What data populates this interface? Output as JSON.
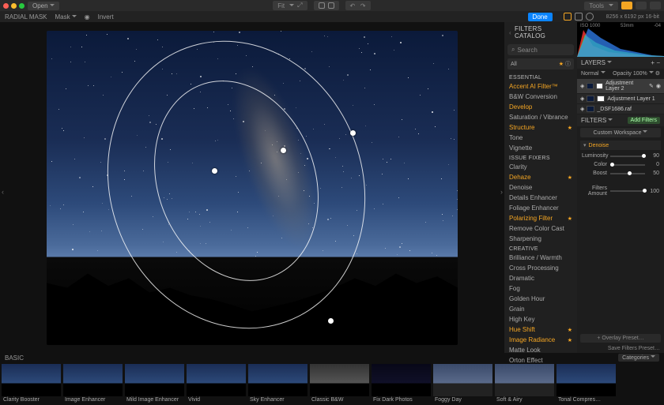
{
  "topbar": {
    "open": "Open"
  },
  "secbar": {
    "title": "RADIAL MASK",
    "mask": "Mask",
    "invert": "Invert",
    "tools": "Tools",
    "done": "Done",
    "imginfo": "8256 x 6192 px   16-bit"
  },
  "histo": {
    "iso": "ISO 1000",
    "focal": "53mm",
    "ev": "-04"
  },
  "catalog": {
    "title": "FILTERS CATALOG",
    "search_ph": "Search",
    "all": "All",
    "sections": [
      {
        "label": "ESSENTIAL",
        "items": [
          {
            "label": "Accent AI Filter™",
            "hl": true
          },
          {
            "label": "B&W Conversion"
          },
          {
            "label": "Develop",
            "hl": true
          },
          {
            "label": "Saturation / Vibrance"
          },
          {
            "label": "Structure",
            "hl": true,
            "fav": true
          },
          {
            "label": "Tone"
          },
          {
            "label": "Vignette"
          }
        ]
      },
      {
        "label": "ISSUE FIXERS",
        "items": [
          {
            "label": "Clarity"
          },
          {
            "label": "Dehaze",
            "hl": true,
            "fav": true
          },
          {
            "label": "Denoise"
          },
          {
            "label": "Details Enhancer"
          },
          {
            "label": "Foliage Enhancer"
          },
          {
            "label": "Polarizing Filter",
            "hl": true,
            "fav": true
          },
          {
            "label": "Remove Color Cast"
          },
          {
            "label": "Sharpening"
          }
        ]
      },
      {
        "label": "CREATIVE",
        "items": [
          {
            "label": "Brilliance / Warmth"
          },
          {
            "label": "Cross Processing"
          },
          {
            "label": "Dramatic"
          },
          {
            "label": "Fog"
          },
          {
            "label": "Golden Hour"
          },
          {
            "label": "Grain"
          },
          {
            "label": "High Key"
          },
          {
            "label": "Hue Shift",
            "hl": true,
            "fav": true
          },
          {
            "label": "Image Radiance",
            "hl": true,
            "fav": true
          },
          {
            "label": "Matte Look"
          },
          {
            "label": "Orton Effect"
          }
        ]
      }
    ]
  },
  "layers": {
    "title": "LAYERS",
    "blend": "Normal",
    "opacity_label": "Opacity",
    "opacity": "100%",
    "items": [
      {
        "name": "Adjustment Layer 2",
        "sel": true
      },
      {
        "name": "Adjustment Layer 1"
      },
      {
        "name": "_DSF1686.raf"
      }
    ]
  },
  "filters": {
    "title": "FILTERS",
    "add": "Add Filters",
    "workspace": "Custom Workspace",
    "group": "Denoise",
    "sliders": [
      {
        "name": "Luminosity",
        "value": 90,
        "pos": 90
      },
      {
        "name": "Color",
        "value": 0,
        "pos": 0
      },
      {
        "name": "Boost",
        "value": 50,
        "pos": 50
      }
    ],
    "amount": {
      "name": "Filters Amount",
      "value": 100,
      "pos": 100
    },
    "overlay": "+ Overlay Preset…",
    "save": "Save Filters Preset…"
  },
  "presets": {
    "section": "BASIC",
    "categories": "Categories",
    "items": [
      {
        "label": "Clarity Booster"
      },
      {
        "label": "Image Enhancer"
      },
      {
        "label": "Mild Image Enhancer"
      },
      {
        "label": "Vivid"
      },
      {
        "label": "Sky Enhancer"
      },
      {
        "label": "Classic B&W",
        "cls": "bw"
      },
      {
        "label": "Fix Dark Photos",
        "cls": "dark"
      },
      {
        "label": "Foggy Day",
        "cls": "fog"
      },
      {
        "label": "Soft & Airy",
        "cls": "fog"
      },
      {
        "label": "Tonal Compres…"
      }
    ]
  }
}
